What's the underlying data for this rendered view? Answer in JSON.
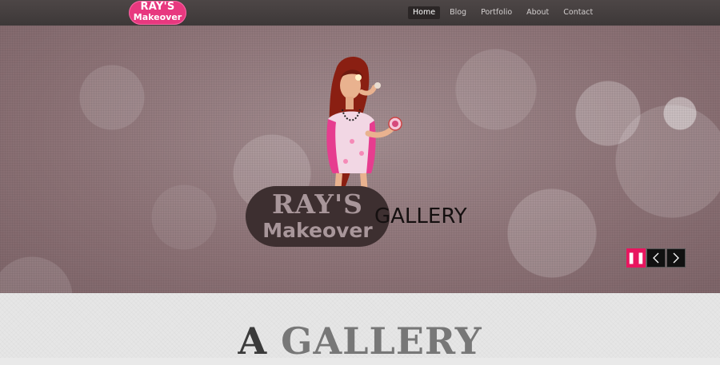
{
  "header": {
    "logo_line1": "RAY'S",
    "logo_line2": "Makeover",
    "nav": [
      {
        "label": "Home",
        "active": true
      },
      {
        "label": "Blog"
      },
      {
        "label": "Portfolio"
      },
      {
        "label": "About"
      },
      {
        "label": "Contact"
      }
    ]
  },
  "hero": {
    "brand_line1": "RAY'S",
    "brand_line2": "Makeover",
    "word": "GALLERY",
    "controls": {
      "pause": "pause-icon",
      "prev": "chevron-left-icon",
      "next": "chevron-right-icon"
    }
  },
  "section": {
    "title_first": "A",
    "title_rest": "GALLERY"
  },
  "colors": {
    "accent": "#e8155f",
    "logo_pink": "#e8387f",
    "topbar": "#433d3d"
  }
}
